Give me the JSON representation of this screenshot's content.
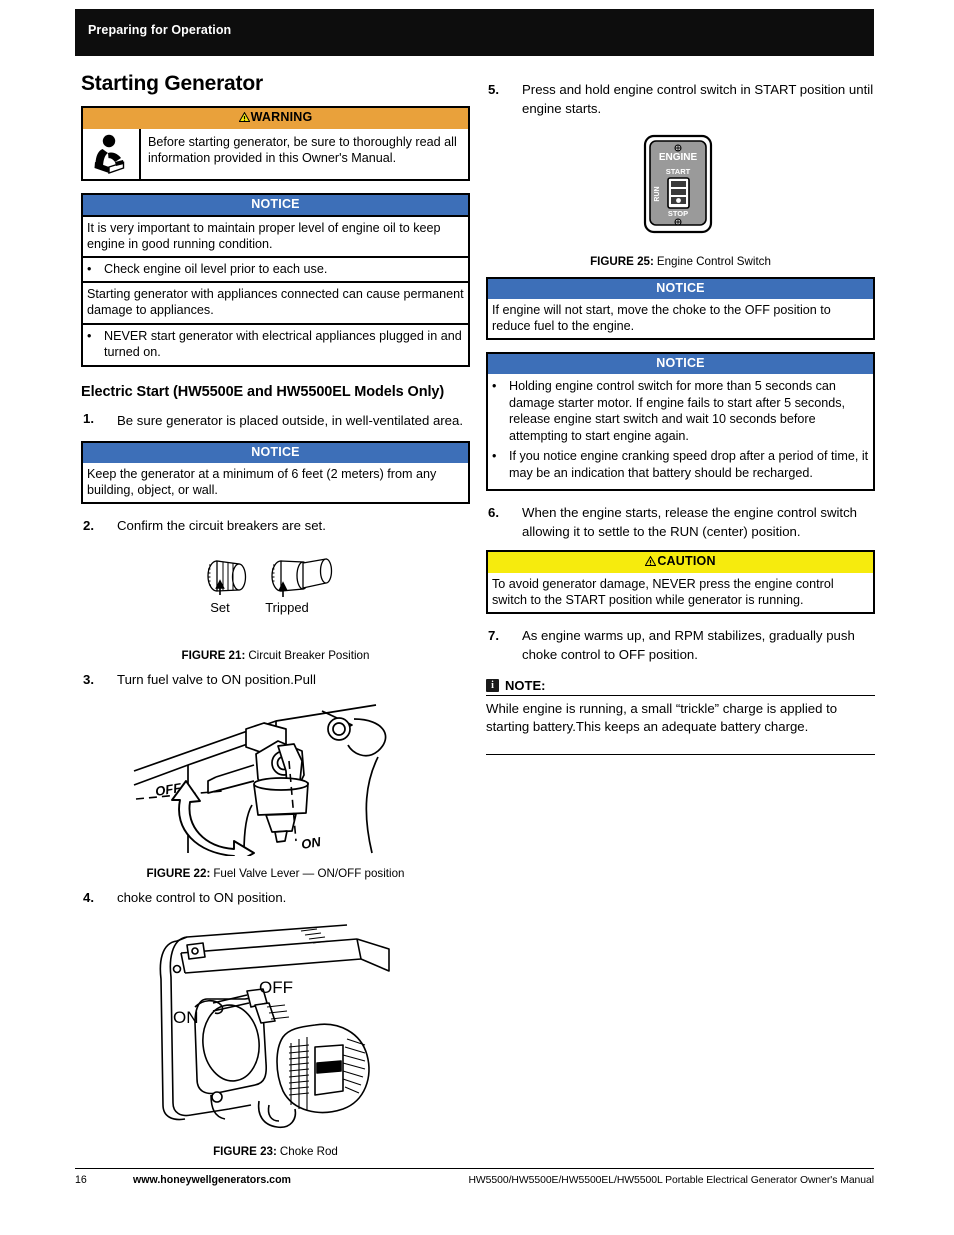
{
  "header": {
    "title": "Preparing for Operation"
  },
  "left": {
    "section_title": "Starting Generator",
    "warning": {
      "label": "WARNING",
      "icon": "read-manual-icon",
      "text": "Before starting generator, be sure to thoroughly read all information provided in this Owner's Manual."
    },
    "notice_oil": {
      "label": "NOTICE",
      "rows": [
        {
          "type": "text",
          "text": "It is very important to maintain proper level of engine oil to keep engine in good running condition."
        },
        {
          "type": "bullet",
          "text": "Check engine oil level prior to each use."
        },
        {
          "type": "text",
          "text": "Starting generator with appliances connected can cause permanent damage to appliances."
        },
        {
          "type": "bullet",
          "text": "NEVER start generator with electrical appliances plugged in and turned on."
        }
      ]
    },
    "sub_title": "Electric Start (HW5500E and HW5500EL Models Only)",
    "step1": {
      "num": "1.",
      "text": "Be sure generator is placed outside, in well-ventilated area."
    },
    "notice_distance": {
      "label": "NOTICE",
      "text": "Keep the generator at a minimum of 6 feet (2 meters) from any building, object, or wall."
    },
    "step2": {
      "num": "2.",
      "text": "Confirm the circuit breakers are set."
    },
    "figure21": {
      "number": "FIGURE 21:",
      "caption": "Circuit Breaker Position",
      "label_set": "Set",
      "label_tripped": "Tripped"
    },
    "step3": {
      "num": "3.",
      "text": "Turn fuel valve to ON position.Pull"
    },
    "figure22": {
      "number": "FIGURE 22:",
      "caption": "Fuel Valve Lever — ON/OFF position",
      "label_off": "OFF",
      "label_on": "ON"
    },
    "step4": {
      "num": "4.",
      "text": "choke control to ON position."
    },
    "figure23": {
      "number": "FIGURE 23:",
      "caption": "Choke Rod",
      "label_off": "OFF",
      "label_on": "ON"
    }
  },
  "right": {
    "step5": {
      "num": "5.",
      "text": "Press and hold engine control switch in START position until engine starts."
    },
    "figure25": {
      "number": "FIGURE 25:",
      "caption": "Engine Control Switch",
      "panel_title": "ENGINE",
      "label_start": "START",
      "label_run": "RUN",
      "label_stop": "STOP"
    },
    "notice_choke": {
      "label": "NOTICE",
      "text": "If engine will not start, move the choke to the OFF position to reduce fuel to the engine."
    },
    "notice_holding": {
      "label": "NOTICE",
      "bullets": [
        "Holding engine control switch for more than 5 seconds can damage starter motor. If engine fails to start after 5 seconds, release engine start switch and wait 10 seconds before attempting to start engine again.",
        "If you notice engine cranking speed drop after a period of time, it may be an indication that battery should be recharged."
      ]
    },
    "step6": {
      "num": "6.",
      "text": "When the engine starts, release the engine control switch allowing it to settle to the RUN (center) position."
    },
    "caution": {
      "label": "CAUTION",
      "text": "To avoid generator damage, NEVER press the engine control switch to the START position while generator is running."
    },
    "step7": {
      "num": "7.",
      "text": "As engine warms up, and RPM stabilizes, gradually push choke control to OFF position."
    },
    "note": {
      "label": "NOTE:",
      "icon": "info-icon",
      "text": "While engine is running, a small “trickle” charge is applied to starting battery.This keeps an adequate battery charge."
    }
  },
  "footer": {
    "page_number": "16",
    "website": "www.honeywellgenerators.com",
    "manual_title": "HW5500/HW5500E/HW5500EL/HW5500L Portable Electrical Generator Owner's Manual"
  },
  "colors": {
    "notice_blue": "#3d6fb8",
    "warning_orange": "#e9a13b",
    "caution_yellow": "#f6eb0d",
    "header_black": "#0d0d0d"
  }
}
